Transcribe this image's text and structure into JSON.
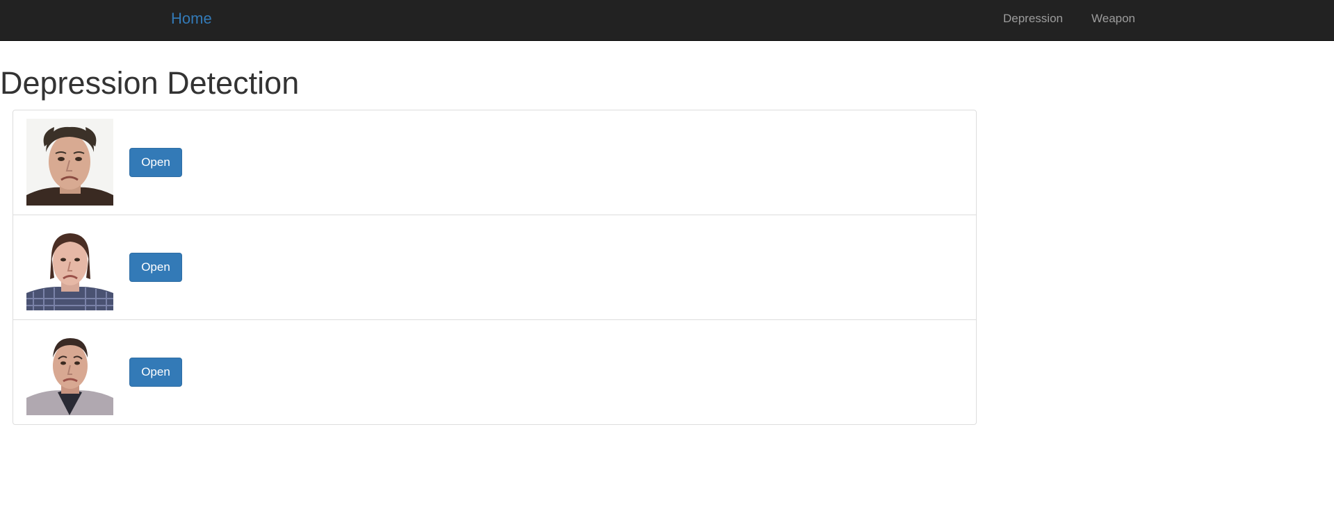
{
  "navbar": {
    "brand": "Home",
    "links": [
      "Depression",
      "Weapon"
    ]
  },
  "page": {
    "title": "Depression Detection"
  },
  "list": {
    "items": [
      {
        "image": "face-photo-sad-man-1",
        "button_label": "Open"
      },
      {
        "image": "face-photo-sad-man-2",
        "button_label": "Open"
      },
      {
        "image": "face-photo-sad-man-3",
        "button_label": "Open"
      }
    ]
  },
  "colors": {
    "navbar_bg": "#222222",
    "brand": "#337ab7",
    "nav_link": "#9d9d9d",
    "button_bg": "#337ab7"
  }
}
